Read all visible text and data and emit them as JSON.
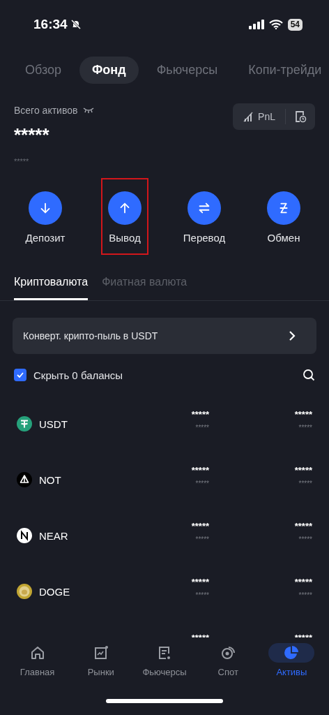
{
  "status_bar": {
    "time": "16:34",
    "muted": true,
    "battery": "54"
  },
  "tabs": [
    {
      "label": "Обзор",
      "selected": false
    },
    {
      "label": "Фонд",
      "selected": true
    },
    {
      "label": "Фьючерсы",
      "selected": false
    },
    {
      "label": "Копи-трейди",
      "selected": false
    }
  ],
  "total": {
    "label": "Всего активов",
    "value": "*****",
    "sub_value": "*****"
  },
  "pnl_button": {
    "label": "PnL"
  },
  "actions": [
    {
      "label": "Депозит",
      "kind": "deposit",
      "highlighted": false
    },
    {
      "label": "Вывод",
      "kind": "withdraw",
      "highlighted": true
    },
    {
      "label": "Перевод",
      "kind": "transfer",
      "highlighted": false
    },
    {
      "label": "Обмен",
      "kind": "convert",
      "highlighted": false
    }
  ],
  "segments": [
    {
      "label": "Криптовалюта",
      "selected": true
    },
    {
      "label": "Фиатная валюта",
      "selected": false
    }
  ],
  "banner": {
    "text": "Конверт. крипто-пыль в USDT"
  },
  "filter": {
    "label": "Скрыть 0 балансы",
    "checked": true
  },
  "assets": [
    {
      "symbol": "USDT",
      "kind": "usdt",
      "value_1": "*****",
      "value_1_sub": "*****",
      "value_2": "*****",
      "value_2_sub": "*****"
    },
    {
      "symbol": "NOT",
      "kind": "not",
      "value_1": "*****",
      "value_1_sub": "*****",
      "value_2": "*****",
      "value_2_sub": "*****"
    },
    {
      "symbol": "NEAR",
      "kind": "near",
      "value_1": "*****",
      "value_1_sub": "*****",
      "value_2": "*****",
      "value_2_sub": "*****"
    },
    {
      "symbol": "DOGE",
      "kind": "doge",
      "value_1": "*****",
      "value_1_sub": "*****",
      "value_2": "*****",
      "value_2_sub": "*****"
    },
    {
      "value_1": "*****",
      "value_2": "*****"
    }
  ],
  "nav": [
    {
      "label": "Главная",
      "kind": "home",
      "selected": false
    },
    {
      "label": "Рынки",
      "kind": "markets",
      "selected": false
    },
    {
      "label": "Фьючерсы",
      "kind": "futures",
      "selected": false
    },
    {
      "label": "Спот",
      "kind": "spot",
      "selected": false
    },
    {
      "label": "Активы",
      "kind": "assets",
      "selected": true
    }
  ]
}
